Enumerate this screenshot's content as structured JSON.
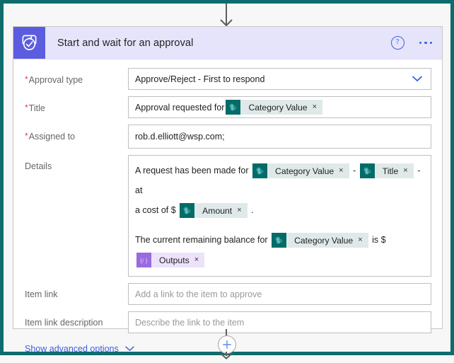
{
  "card": {
    "header": {
      "title": "Start and wait for an approval",
      "icon": "approval-shield-check-icon",
      "help_icon": "help-question-icon",
      "menu_icon": "more-options-ellipsis-icon",
      "tile_color": "#5c5ce0",
      "bar_color": "#e6e4fb"
    },
    "fields": [
      {
        "label": "Approval type",
        "required": true,
        "value": "Approve/Reject - First to respond",
        "control": "dropdown"
      },
      {
        "label": "Title",
        "required": true,
        "control": "token-input"
      },
      {
        "label": "Assigned to",
        "required": true,
        "value": "rob.d.elliott@wsp.com;",
        "control": "text"
      },
      {
        "label": "Details",
        "required": false,
        "control": "token-textarea"
      },
      {
        "label": "Item link",
        "required": false,
        "value": "",
        "placeholder": "Add a link to the item to approve",
        "control": "text"
      },
      {
        "label": "Item link description",
        "required": false,
        "value": "",
        "placeholder": "Describe the link to the item",
        "control": "text"
      }
    ],
    "title_field": {
      "prefix_text": "Approval requested for",
      "chip": {
        "label": "Category Value",
        "source": "sharepoint",
        "remove": "×"
      }
    },
    "details_field": {
      "line1_a": "A request has been made for",
      "chip1": {
        "label": "Category Value",
        "source": "sharepoint",
        "remove": "×"
      },
      "sep1": "-",
      "chip2": {
        "label": "Title",
        "source": "sharepoint",
        "remove": "×"
      },
      "line1_b": "- at",
      "line2_a": "a cost of $",
      "chip3": {
        "label": "Amount",
        "source": "sharepoint",
        "remove": "×"
      },
      "line2_b": ".",
      "line3_a": "The current remaining balance for",
      "chip4": {
        "label": "Category Value",
        "source": "sharepoint",
        "remove": "×"
      },
      "line3_b": "is $",
      "chip5": {
        "label": "Outputs",
        "source": "expression",
        "remove": "×"
      }
    },
    "advanced": {
      "label": "Show advanced options",
      "chevron": "chevron-down-icon"
    }
  },
  "connectors": {
    "top_arrow": "arrow-down-icon",
    "add_step": "add-step-plus-icon",
    "bottom_arrow": "arrow-down-icon"
  },
  "colors": {
    "accent_blue": "#3b5fe0",
    "tile_purple": "#5c5ce0",
    "chip_sharepoint_icon": "#036b68",
    "chip_sharepoint_bg": "#dfe9e9",
    "chip_expression_icon": "#9a6ae0",
    "chip_expression_bg": "#ece2fb",
    "required_asterisk": "#e03e3e",
    "frame_teal": "#0f6c6c"
  }
}
